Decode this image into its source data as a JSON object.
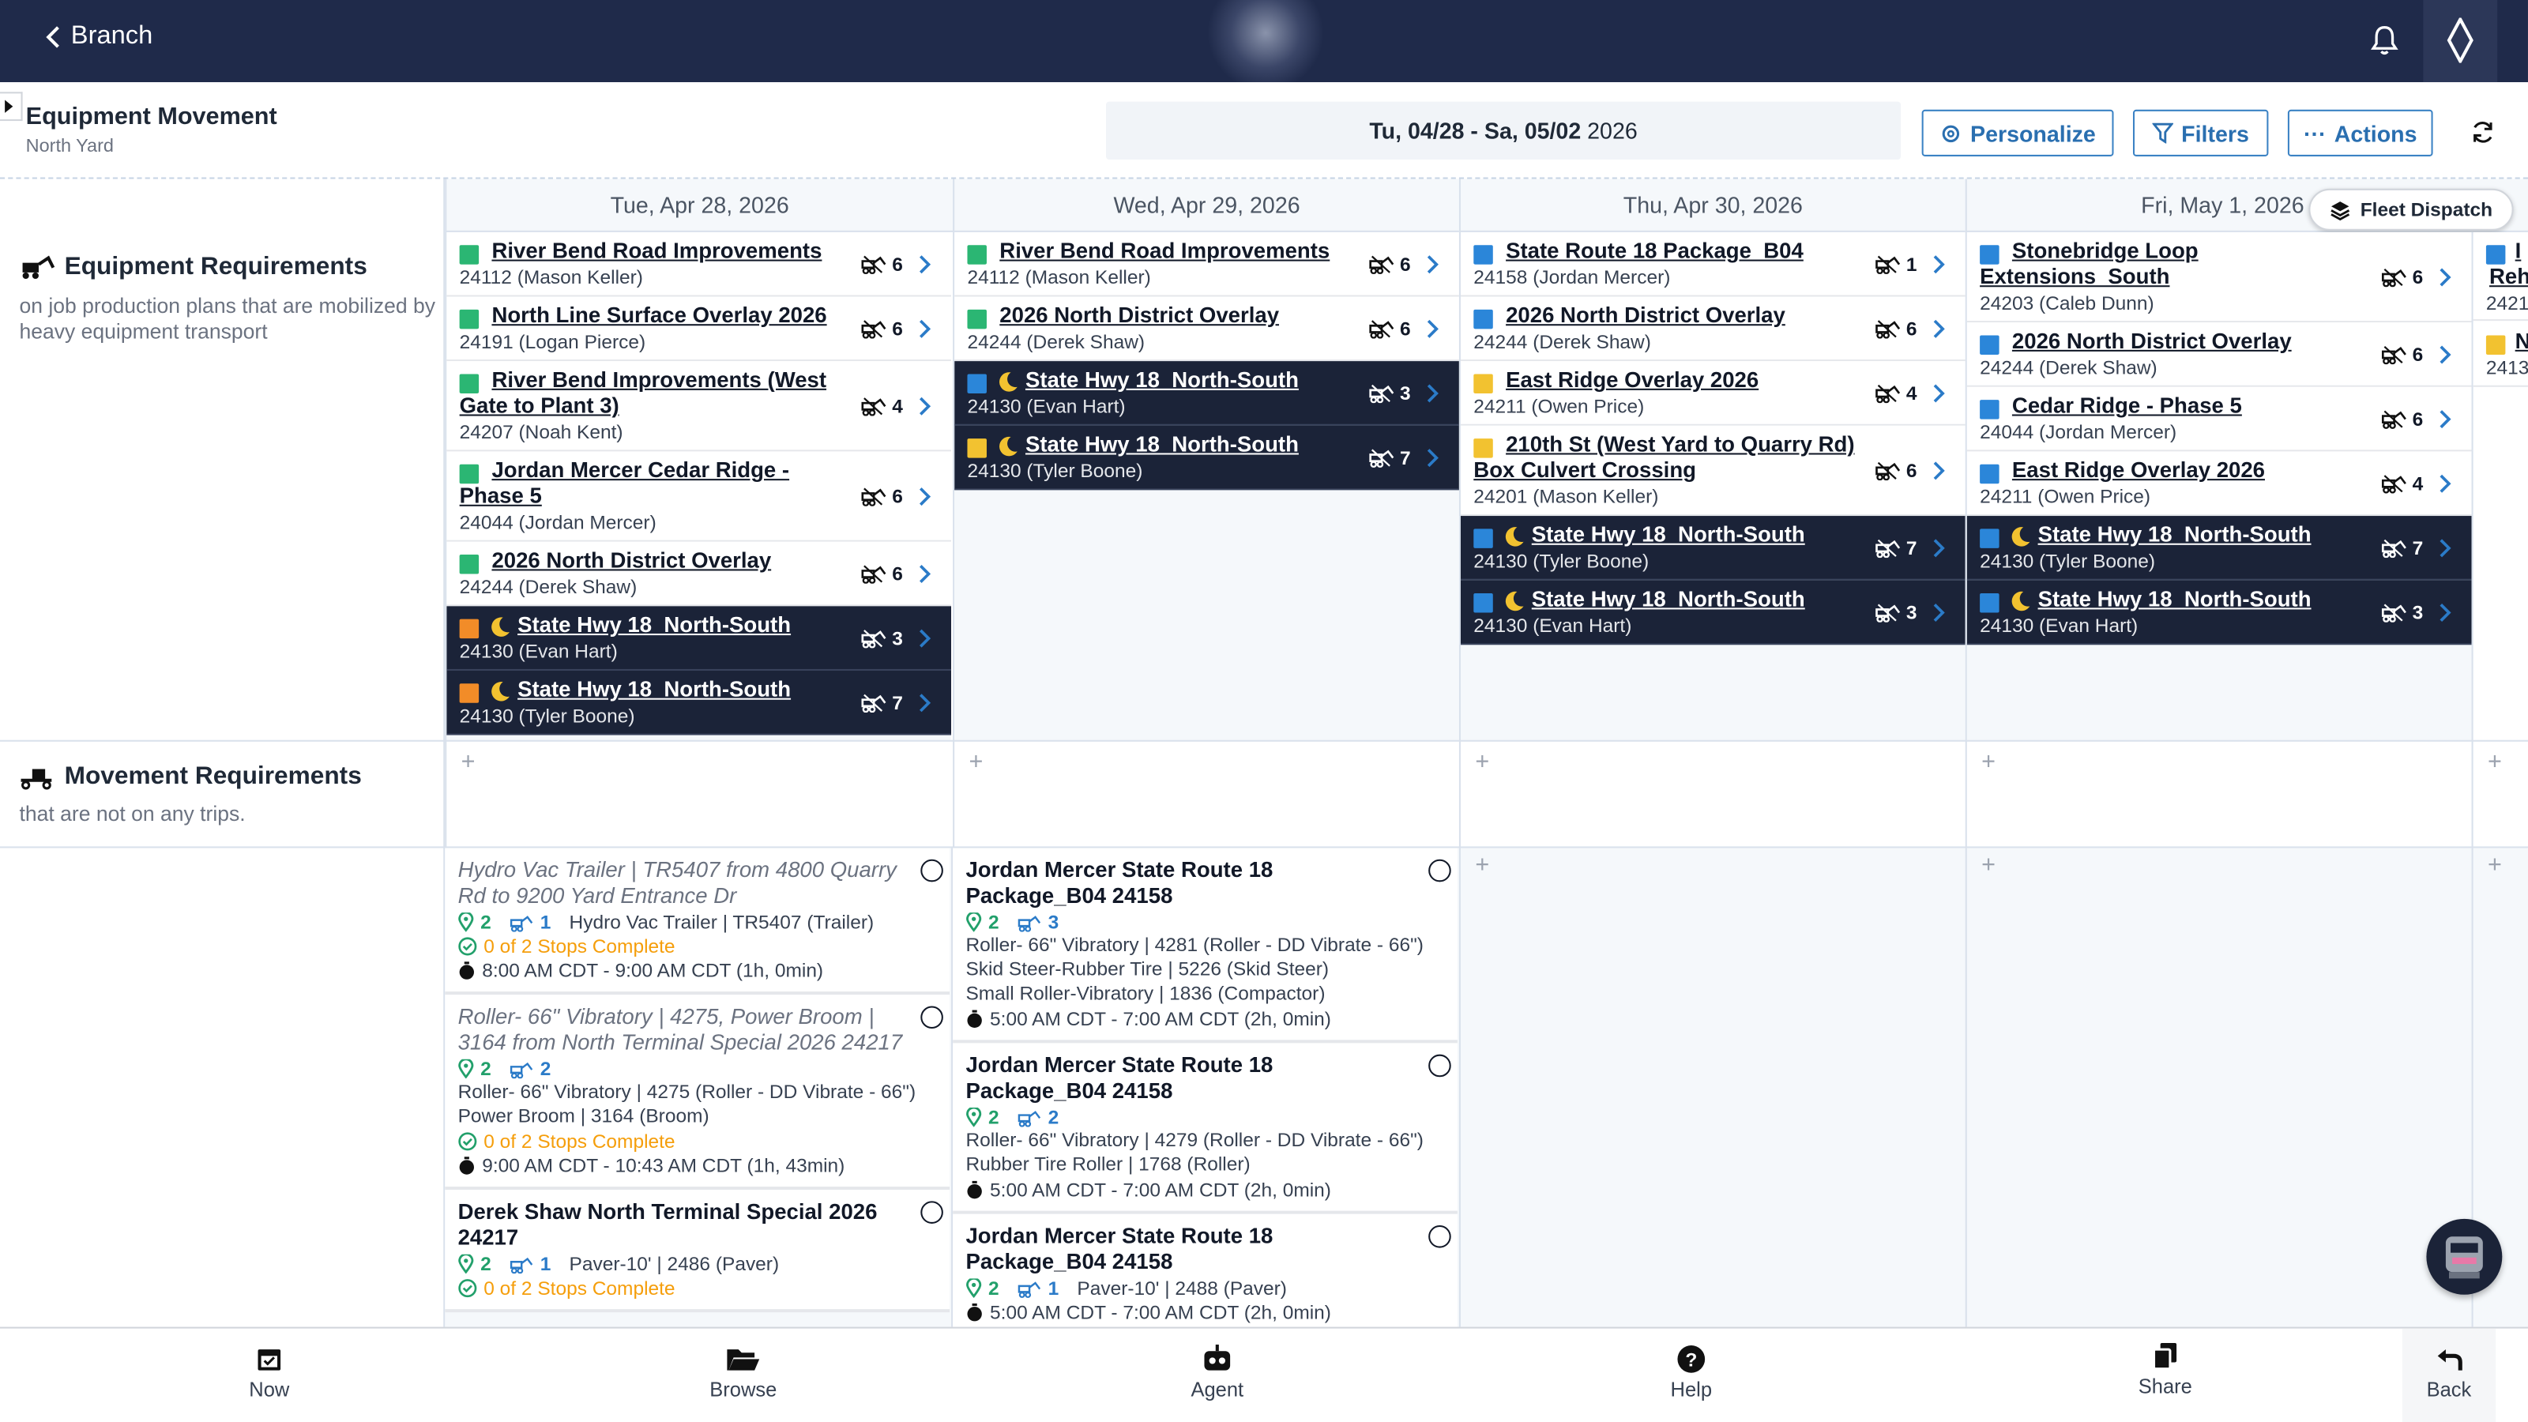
{
  "topbar": {
    "back_label": "Branch"
  },
  "header": {
    "title": "Equipment Movement",
    "subtitle": "North Yard",
    "date_bold": "Tu, 04/28 - Sa, 05/02",
    "date_year": "2026",
    "personalize": "Personalize",
    "filters": "Filters",
    "actions": "Actions"
  },
  "days": [
    "Tue, Apr 28, 2026",
    "Wed, Apr 29, 2026",
    "Thu, Apr 30, 2026",
    "Fri, May 1, 2026"
  ],
  "fleet_dispatch": "Fleet Dispatch",
  "left": {
    "eq_title": "Equipment Requirements",
    "eq_desc": "on job production plans that are mobilized by heavy equipment transport",
    "mv_title": "Movement Requirements",
    "mv_desc": "that are not on any trips."
  },
  "colors": {
    "green": "#2bb673",
    "orange": "#f28c28",
    "blue": "#2b86d9",
    "yellow": "#f2c230",
    "navy": "#1f2a4a"
  },
  "col1": [
    {
      "name": "River Bend Road Improvements",
      "sub": "24112 (Mason Keller)",
      "count": "6"
    },
    {
      "name": "North Line Surface Overlay 2026",
      "sub": "24191 (Logan Pierce)",
      "count": "6"
    },
    {
      "name": "River Bend Improvements (West",
      "name2": "Gate to Plant 3)",
      "sub": "24207 (Noah Kent)",
      "count": "4"
    },
    {
      "name": "Jordan Mercer Cedar Ridge -",
      "name2": "Phase 5",
      "sub": "24044 (Jordan Mercer)",
      "count": "6"
    },
    {
      "name": "2026 North District Overlay",
      "sub": "24244 (Derek Shaw)",
      "count": "6"
    },
    {
      "name": "State Hwy 18_North-South",
      "sub": "24130 (Evan Hart)",
      "count": "3"
    },
    {
      "name": "State Hwy 18_North-South",
      "sub": "24130 (Tyler Boone)",
      "count": "7"
    }
  ],
  "col2": [
    {
      "name": "River Bend Road Improvements",
      "sub": "24112 (Mason Keller)",
      "count": "6"
    },
    {
      "name": "2026 North District Overlay",
      "sub": "24244 (Derek Shaw)",
      "count": "6"
    },
    {
      "name": "State Hwy 18_North-South",
      "sub": "24130 (Evan Hart)",
      "count": "3"
    },
    {
      "name": "State Hwy 18_North-South",
      "sub": "24130 (Tyler Boone)",
      "count": "7"
    }
  ],
  "col3": [
    {
      "name": "State Route 18 Package_B04",
      "sub": "24158 (Jordan Mercer)",
      "count": "1"
    },
    {
      "name": "2026 North District Overlay",
      "sub": "24244 (Derek Shaw)",
      "count": "6"
    },
    {
      "name": "East Ridge Overlay 2026",
      "sub": "24211 (Owen Price)",
      "count": "4"
    },
    {
      "name": "210th St (West Yard to Quarry Rd)",
      "name2": "Box Culvert Crossing",
      "sub": "24201 (Mason Keller)",
      "count": "6"
    },
    {
      "name": "State Hwy 18_North-South",
      "sub": "24130 (Tyler Boone)",
      "count": "7"
    },
    {
      "name": "State Hwy 18_North-South",
      "sub": "24130 (Evan Hart)",
      "count": "3"
    }
  ],
  "col4": [
    {
      "name": "Stonebridge Loop",
      "name2": "Extensions_South",
      "sub": "24203 (Caleb Dunn)",
      "count": "6"
    },
    {
      "name": "2026 North District Overlay",
      "sub": "24244 (Derek Shaw)",
      "count": "6"
    },
    {
      "name": "Cedar Ridge - Phase 5",
      "sub": "24044 (Jordan Mercer)",
      "count": "6"
    },
    {
      "name": "East Ridge Overlay 2026",
      "sub": "24211 (Owen Price)",
      "count": "4"
    },
    {
      "name": "State Hwy 18_North-South",
      "sub": "24130 (Tyler Boone)",
      "count": "7"
    },
    {
      "name": "State Hwy 18_North-South",
      "sub": "24130 (Evan Hart)",
      "count": "3"
    }
  ],
  "col5": [
    {
      "name": "I",
      "sub": "Reh"
    },
    {
      "sub": "2421"
    },
    {
      "name": "N",
      "sub": "2413"
    }
  ],
  "trips1": [
    {
      "title": "Hydro Vac Trailer | TR5407 from 4800 Quarry Rd to 9200 Yard Entrance Dr",
      "stops": "2",
      "eq": "1",
      "eqtext": "Hydro Vac Trailer | TR5407 (Trailer)",
      "complete": "0 of 2 Stops Complete",
      "time": "8:00 AM CDT - 9:00 AM CDT (1h, 0min)"
    },
    {
      "title": "Roller- 66\" Vibratory | 4275, Power Broom | 3164 from North Terminal Special 2026 24217",
      "stops": "2",
      "eq": "2",
      "line1": "Roller- 66\" Vibratory | 4275 (Roller - DD Vibrate - 66\")",
      "line2": "Power Broom | 3164 (Broom)",
      "complete": "0 of 2 Stops Complete",
      "time": "9:00 AM CDT - 10:43 AM CDT (1h, 43min)"
    },
    {
      "title": "Derek Shaw North Terminal Special 2026 24217",
      "stops": "2",
      "eq": "1",
      "eqtext": "Paver-10' | 2486 (Paver)",
      "complete": "0 of 2 Stops Complete"
    }
  ],
  "trips2": [
    {
      "title": "Jordan Mercer State Route 18 Package_B04 24158",
      "stops": "2",
      "eq": "3",
      "line1": "Roller- 66\" Vibratory | 4281 (Roller - DD Vibrate - 66\")",
      "line2": "Skid Steer-Rubber Tire | 5226 (Skid Steer)",
      "line3": "Small Roller-Vibratory | 1836 (Compactor)",
      "time": "5:00 AM CDT - 7:00 AM CDT (2h, 0min)"
    },
    {
      "title": "Jordan Mercer State Route 18 Package_B04 24158",
      "stops": "2",
      "eq": "2",
      "line1": "Roller- 66\" Vibratory | 4279 (Roller - DD Vibrate - 66\")",
      "line2": "Rubber Tire Roller | 1768 (Roller)",
      "time": "5:00 AM CDT - 7:00 AM CDT (2h, 0min)"
    },
    {
      "title": "Jordan Mercer State Route 18 Package_B04 24158",
      "stops": "2",
      "eq": "1",
      "eqtext": "Paver-10' | 2488 (Paver)",
      "time": "5:00 AM CDT - 7:00 AM CDT (2h, 0min)"
    }
  ],
  "plus": "+",
  "bottom": {
    "now": "Now",
    "browse": "Browse",
    "agent": "Agent",
    "help": "Help",
    "share": "Share",
    "back": "Back"
  }
}
